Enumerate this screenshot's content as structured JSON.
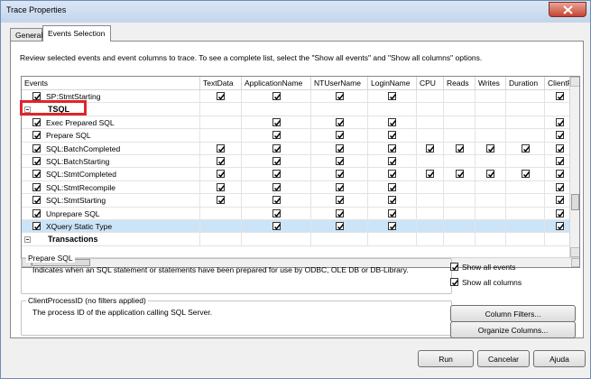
{
  "window": {
    "title": "Trace Properties"
  },
  "tabs": [
    {
      "label": "General"
    },
    {
      "label": "Events Selection"
    }
  ],
  "description": "Review selected events and event columns to trace. To see a complete list, select the \"Show all events\" and \"Show all columns\" options.",
  "grid": {
    "columns": [
      "Events",
      "TextData",
      "ApplicationName",
      "NTUserName",
      "LoginName",
      "CPU",
      "Reads",
      "Writes",
      "Duration",
      "ClientProc"
    ],
    "rows": [
      {
        "label": "SP:StmtStarting",
        "type": "event",
        "checked": true,
        "cols": [
          1,
          1,
          1,
          1,
          0,
          0,
          0,
          0,
          1
        ]
      },
      {
        "label": "TSQL",
        "type": "category",
        "checked": false,
        "cols": [
          0,
          0,
          0,
          0,
          0,
          0,
          0,
          0,
          0
        ]
      },
      {
        "label": "Exec Prepared SQL",
        "type": "event",
        "checked": true,
        "cols": [
          0,
          1,
          1,
          1,
          0,
          0,
          0,
          0,
          1
        ]
      },
      {
        "label": "Prepare SQL",
        "type": "event",
        "checked": true,
        "cols": [
          0,
          1,
          1,
          1,
          0,
          0,
          0,
          0,
          1
        ]
      },
      {
        "label": "SQL:BatchCompleted",
        "type": "event",
        "checked": true,
        "cols": [
          1,
          1,
          1,
          1,
          1,
          1,
          1,
          1,
          1
        ]
      },
      {
        "label": "SQL:BatchStarting",
        "type": "event",
        "checked": true,
        "cols": [
          1,
          1,
          1,
          1,
          0,
          0,
          0,
          0,
          1
        ]
      },
      {
        "label": "SQL:StmtCompleted",
        "type": "event",
        "checked": true,
        "cols": [
          1,
          1,
          1,
          1,
          1,
          1,
          1,
          1,
          1
        ]
      },
      {
        "label": "SQL:StmtRecompile",
        "type": "event",
        "checked": true,
        "cols": [
          1,
          1,
          1,
          1,
          0,
          0,
          0,
          0,
          1
        ]
      },
      {
        "label": "SQL:StmtStarting",
        "type": "event",
        "checked": true,
        "cols": [
          1,
          1,
          1,
          1,
          0,
          0,
          0,
          0,
          1
        ]
      },
      {
        "label": "Unprepare SQL",
        "type": "event",
        "checked": true,
        "cols": [
          0,
          1,
          1,
          1,
          0,
          0,
          0,
          0,
          1
        ]
      },
      {
        "label": "XQuery Static Type",
        "type": "event",
        "checked": true,
        "cols": [
          0,
          1,
          1,
          1,
          0,
          0,
          0,
          0,
          1
        ],
        "selected": true
      },
      {
        "label": "Transactions",
        "type": "category",
        "checked": false,
        "cols": [
          0,
          0,
          0,
          0,
          0,
          0,
          0,
          0,
          0
        ]
      }
    ]
  },
  "prepare_sql_group": {
    "title": "Prepare SQL",
    "text": "Indicates when an SQL statement or statements have been prepared for use by ODBC, OLE DB or DB-Library."
  },
  "client_group": {
    "title": "ClientProcessID (no filters applied)",
    "text": "The process ID of the application calling SQL Server."
  },
  "options": {
    "show_all_events": "Show all events",
    "show_all_columns": "Show all columns"
  },
  "buttons": {
    "column_filters": "Column Filters...",
    "organize_columns": "Organize Columns...",
    "run": "Run",
    "cancel": "Cancelar",
    "help": "Ajuda"
  }
}
